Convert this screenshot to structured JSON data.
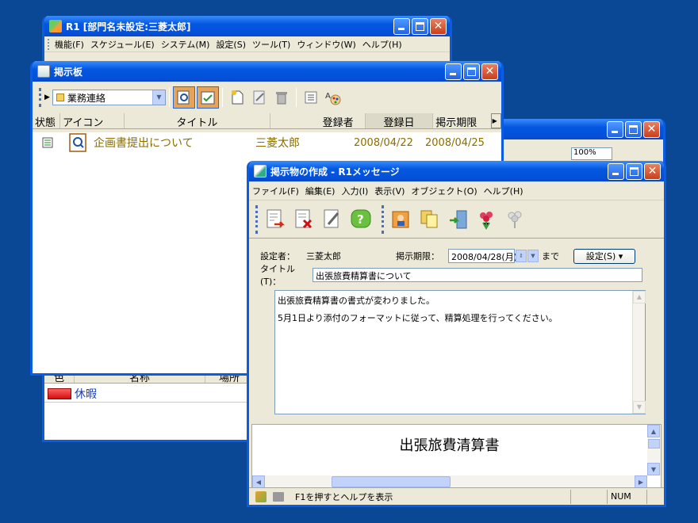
{
  "main_window": {
    "title": "R1 [部門名未設定:三菱太郎]",
    "menu": [
      "機能(F)",
      "スケジュール(E)",
      "システム(M)",
      "設定(S)",
      "ツール(T)",
      "ウィンドウ(W)",
      "ヘルプ(H)"
    ],
    "table": {
      "headers": [
        "色",
        "名称",
        "場所"
      ],
      "row": {
        "name": "休暇",
        "color": "#e02020"
      }
    }
  },
  "back_window": {
    "zoom_value": "100%"
  },
  "board_window": {
    "title": "掲示板",
    "category_value": "業務連絡",
    "columns": [
      "状態",
      "アイコン",
      "タイトル",
      "登録者",
      "登録日",
      "掲示期限"
    ],
    "rows": [
      {
        "title": "企画書提出について",
        "registrant": "三菱太郎",
        "registered": "2008/04/22",
        "expires": "2008/04/25"
      }
    ]
  },
  "message_window": {
    "title": "掲示物の作成 - R1メッセージ",
    "menu": [
      "ファイル(F)",
      "編集(E)",
      "入力(I)",
      "表示(V)",
      "オブジェクト(O)",
      "ヘルプ(H)"
    ],
    "setter_label": "設定者：",
    "setter_value": "三菱太郎",
    "deadline_label": "掲示期限：",
    "deadline_value": "2008/04/28(月)",
    "deadline_suffix": "まで",
    "settings_button": "設定(S) ▾",
    "title_label": "タイトル(T)：",
    "title_value": "出張旅費精算書について",
    "body_lines": [
      "出張旅費精算書の書式が変わりました。",
      "5月1日より添付のフォーマットに従って、精算処理を行ってください。"
    ],
    "attachment_heading": "出張旅費清算書",
    "status_text": "F1を押すとヘルプを表示",
    "status_num": "NUM"
  },
  "colors": {
    "desktop": "#0a4795",
    "titlebar": "#0457e0",
    "list_text": "#8b6d00"
  }
}
